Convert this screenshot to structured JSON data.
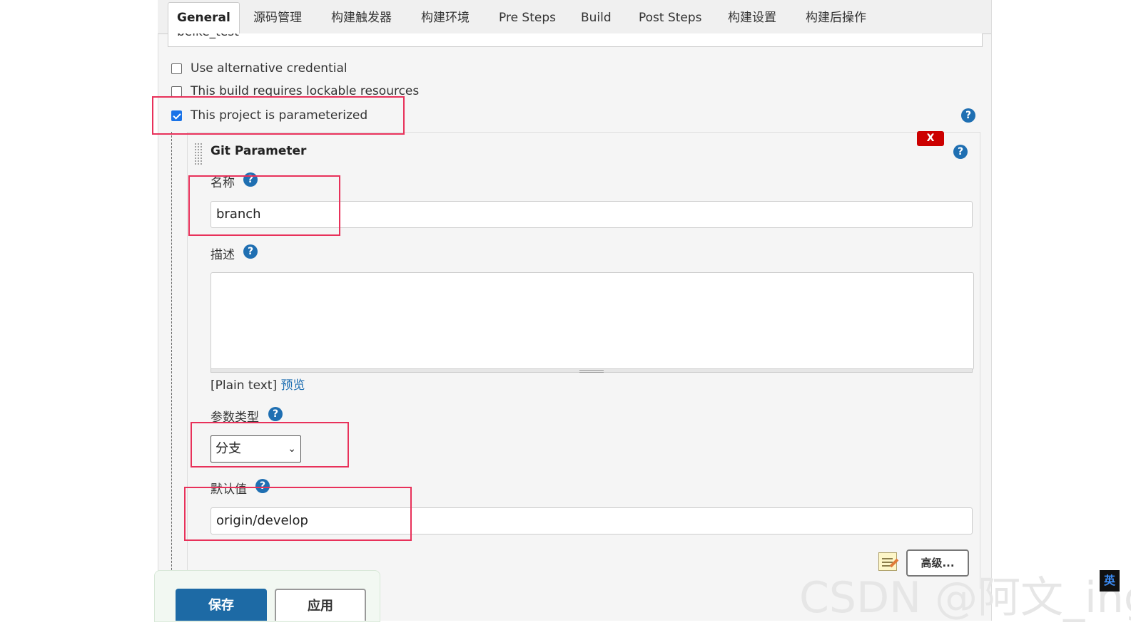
{
  "tabs": [
    "General",
    "源码管理",
    "构建触发器",
    "构建环境",
    "Pre Steps",
    "Build",
    "Post Steps",
    "构建设置",
    "构建后操作"
  ],
  "prev_field_value": "beike_test",
  "options": {
    "alt_credential": "Use alternative credential",
    "lockable": "This build requires lockable resources",
    "parameterized": "This project is parameterized"
  },
  "git_param": {
    "title": "Git Parameter",
    "delete_label": "X",
    "name_label": "名称",
    "name_value": "branch",
    "desc_label": "描述",
    "desc_value": "",
    "plain_text": "[Plain text]",
    "preview_link": "预览",
    "type_label": "参数类型",
    "type_value": "分支",
    "default_label": "默认值",
    "default_value": "origin/develop",
    "advanced_label": "高级..."
  },
  "help_glyph": "?",
  "select_chevron": "⌄",
  "buttons": {
    "save": "保存",
    "apply": "应用"
  },
  "watermark": "CSDN @阿文_ing",
  "ime_indicator": "英",
  "colors": {
    "annotation_red": "#e8315a",
    "primary_blue": "#1d6aa5",
    "help_blue": "#1f6fb2",
    "delete_red": "#cc0000"
  }
}
